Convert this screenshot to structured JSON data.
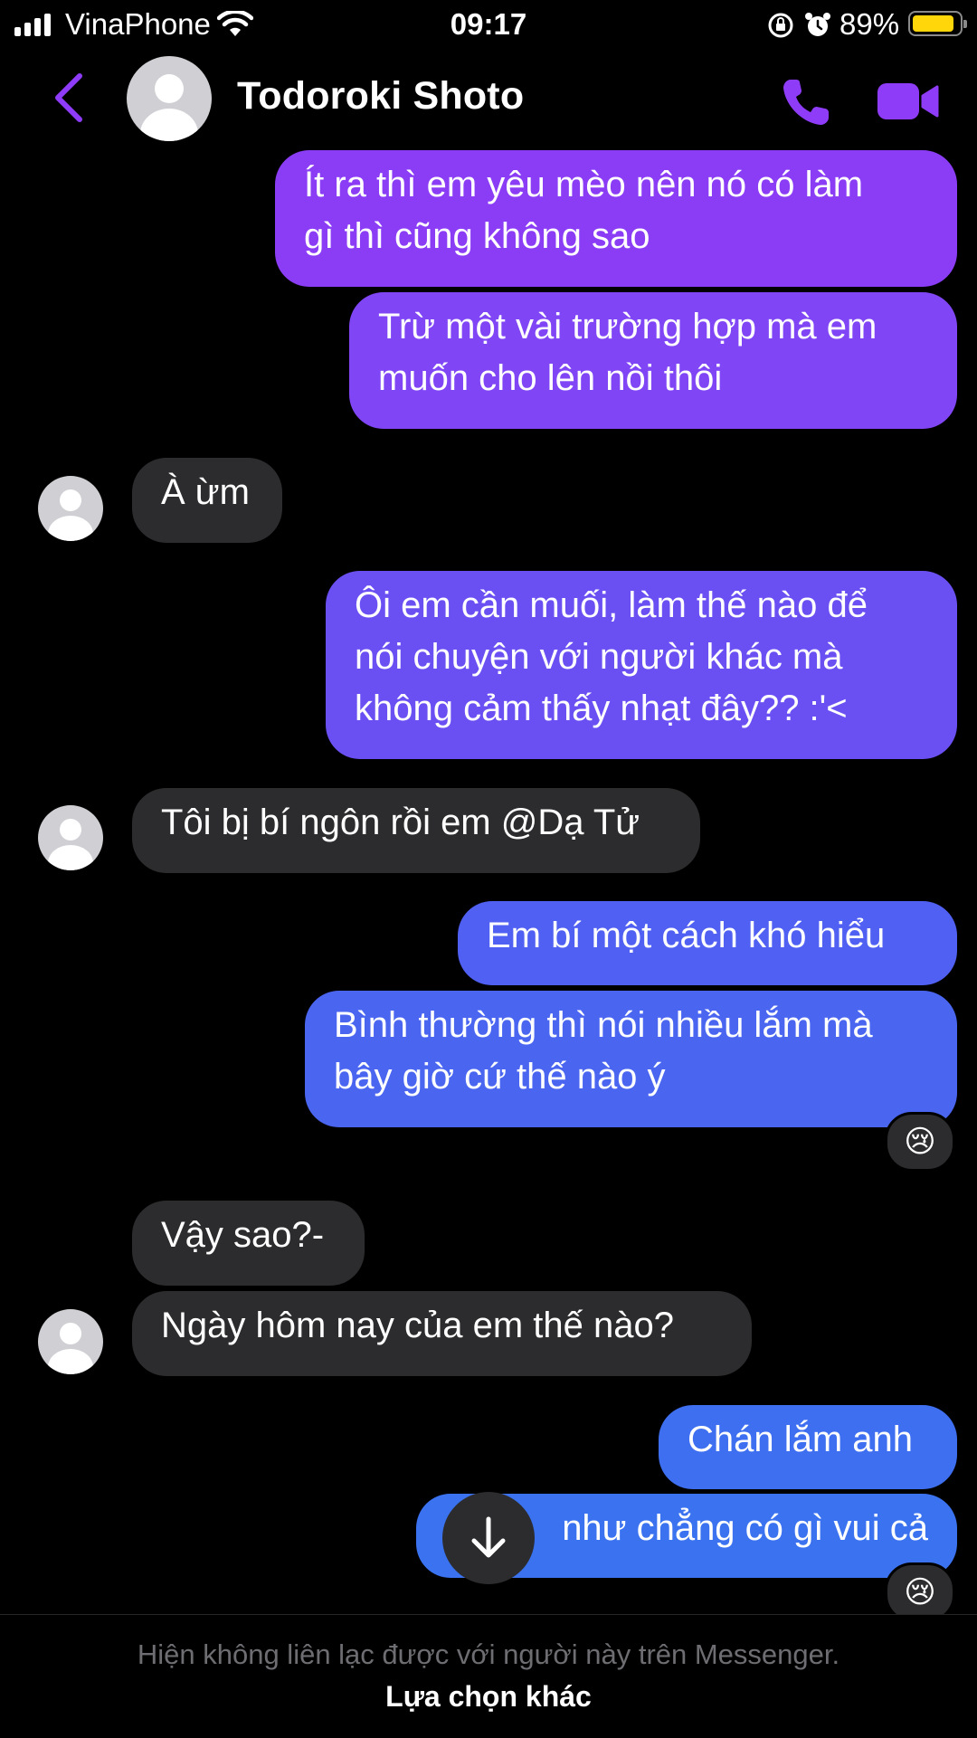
{
  "status_bar": {
    "carrier": "VinaPhone",
    "time": "09:17",
    "battery_percent": "89%",
    "battery_level": 0.89
  },
  "header": {
    "contact_name": "Todoroki Shoto",
    "accent_color": "#8e3cf7"
  },
  "messages": [
    {
      "from": "me",
      "lines": [
        "Ít ra thì em yêu mèo nên nó có làm",
        "gì thì cũng không sao"
      ]
    },
    {
      "from": "me",
      "lines": [
        "Trừ một vài trường hợp mà em",
        "muốn cho lên nồi thôi"
      ]
    },
    {
      "from": "them",
      "lines": [
        "À ừm"
      ]
    },
    {
      "from": "me",
      "lines": [
        "Ôi em cần muối, làm thế nào để",
        "nói chuyện với người khác mà",
        "không cảm thấy nhạt đây?? :'<"
      ]
    },
    {
      "from": "them",
      "lines": [
        "Tôi bị bí ngôn rồi em @Dạ Tử"
      ]
    },
    {
      "from": "me",
      "lines": [
        "Em bí một cách khó hiểu"
      ]
    },
    {
      "from": "me",
      "lines": [
        "Bình thường thì nói nhiều lắm mà",
        "bây giờ cứ thế nào ý"
      ],
      "reaction": "😢"
    },
    {
      "from": "them",
      "lines": [
        "Vậy sao?-"
      ]
    },
    {
      "from": "them",
      "lines": [
        "Ngày hôm nay của em thế nào?"
      ]
    },
    {
      "from": "me",
      "lines": [
        "Chán lắm anh"
      ]
    },
    {
      "from": "me",
      "lines": [
        "như chẳng có gì vui cả"
      ],
      "reaction": "😢"
    }
  ],
  "footer": {
    "notice": "Hiện không liên lạc được với người này trên Messenger.",
    "action": "Lựa chọn khác"
  },
  "colors": {
    "bubble_top": "#8e3cf7",
    "bubble_bottom": "#3a70f0",
    "incoming_bubble": "#2c2c2e"
  }
}
